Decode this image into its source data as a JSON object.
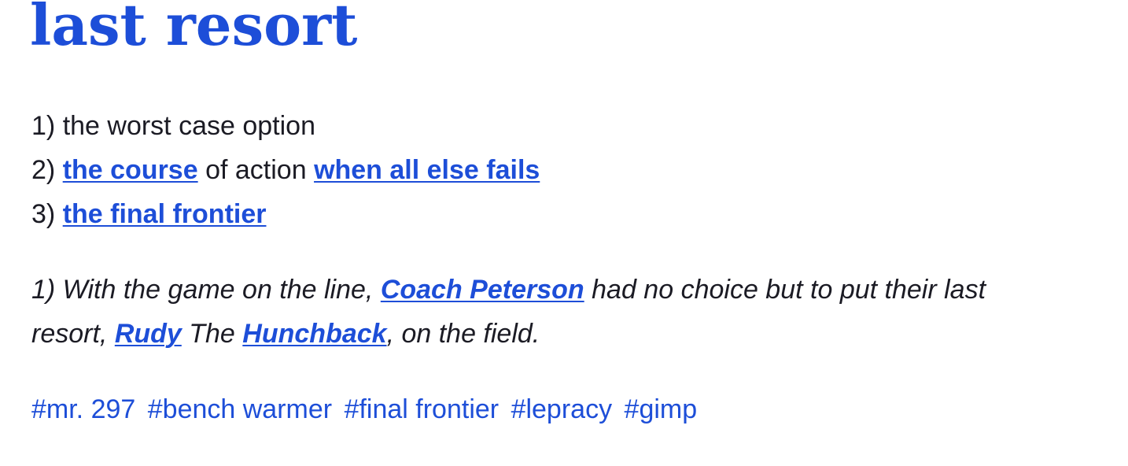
{
  "word": "last resort",
  "meaning": {
    "line1": {
      "prefix": "1) ",
      "text": "the worst case option"
    },
    "line2": {
      "prefix": "2) ",
      "link1": "the course",
      "middle": " of action ",
      "link2": "when all else fails"
    },
    "line3": {
      "prefix": "3) ",
      "link1": "the final frontier"
    }
  },
  "example": {
    "line1": {
      "prefix": "1) With the game on the line, ",
      "link1": "Coach Peterson",
      "suffix": " had no choice but to put their last"
    },
    "line2": {
      "prefix": "resort, ",
      "link1": "Rudy",
      "middle": " The ",
      "link2": "Hunchback",
      "suffix": ", on the field."
    }
  },
  "tags": [
    "#mr. 297",
    "#bench warmer",
    "#final frontier",
    "#lepracy",
    "#gimp"
  ],
  "colors": {
    "accent": "#1d4ed8",
    "text": "#1b1b24",
    "background": "#ffffff"
  }
}
